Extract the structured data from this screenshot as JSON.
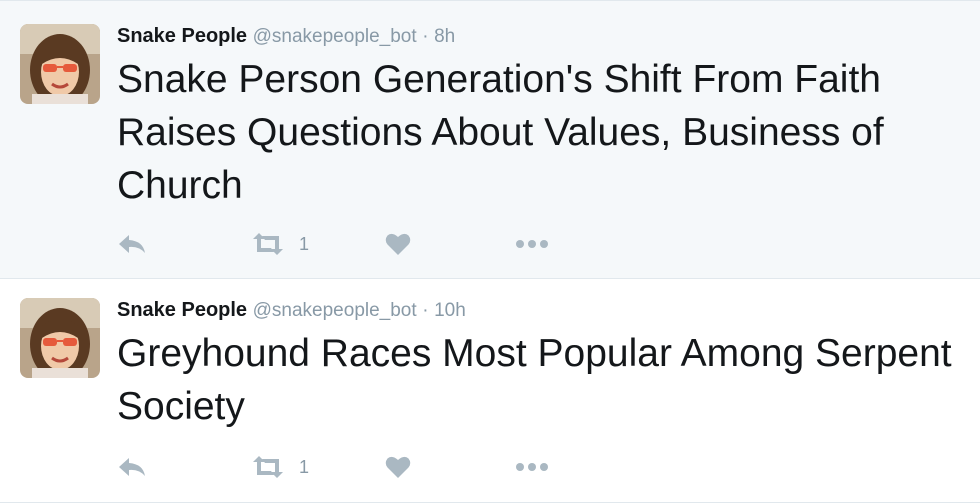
{
  "tweets": [
    {
      "author": "Snake People",
      "handle": "@snakepeople_bot",
      "separator": "·",
      "time": "8h",
      "text": "Snake Person Generation's Shift From Faith Raises Questions About Values, Business of Church",
      "retweet_count": "1"
    },
    {
      "author": "Snake People",
      "handle": "@snakepeople_bot",
      "separator": "·",
      "time": "10h",
      "text": "Greyhound Races Most Popular Among Serpent Society",
      "retweet_count": "1"
    }
  ],
  "icons": {
    "reply": "reply-icon",
    "retweet": "retweet-icon",
    "like": "heart-icon",
    "more": "more-dots-icon"
  },
  "colors": {
    "highlight_background": "#f5f8fa",
    "muted_text": "#8899a6",
    "icon": "#aab8c2",
    "divider": "#e1e8ed"
  }
}
